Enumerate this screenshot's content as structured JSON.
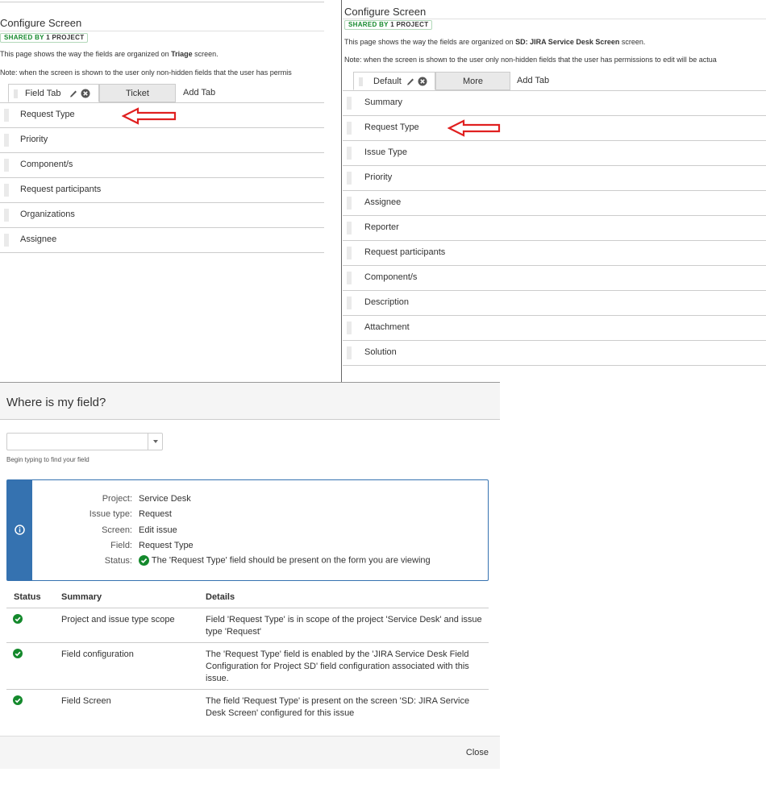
{
  "left": {
    "title": "Configure Screen",
    "shared_prefix": "SHARED BY",
    "shared_count": "1",
    "shared_suffix": "PROJECT",
    "desc_pre": "This page shows the way the fields are organized on",
    "desc_screen": "Triage",
    "desc_post": "screen.",
    "note": "Note: when the screen is shown to the user only non-hidden fields that the user has permis",
    "tabs": [
      {
        "label": "Field Tab"
      },
      {
        "label": "Ticket"
      }
    ],
    "add_tab": "Add Tab",
    "fields": [
      "Request Type",
      "Priority",
      "Component/s",
      "Request participants",
      "Organizations",
      "Assignee"
    ]
  },
  "right": {
    "title": "Configure Screen",
    "shared_prefix": "SHARED BY",
    "shared_count": "1",
    "shared_suffix": "PROJECT",
    "desc_pre": "This page shows the way the fields are organized on",
    "desc_screen": "SD: JIRA Service Desk Screen",
    "desc_post": "screen.",
    "note": "Note: when the screen is shown to the user only non-hidden fields that the user has permissions to edit will be actua",
    "tabs": [
      {
        "label": "Default"
      },
      {
        "label": "More"
      }
    ],
    "add_tab": "Add Tab",
    "fields": [
      "Summary",
      "Request Type",
      "Issue Type",
      "Priority",
      "Assignee",
      "Reporter",
      "Request participants",
      "Component/s",
      "Description",
      "Attachment",
      "Solution"
    ]
  },
  "dialog": {
    "title": "Where is my field?",
    "search_value": "",
    "hint": "Begin typing to find your field",
    "info": {
      "project_key": "Project:",
      "project_val": "Service Desk",
      "issue_type_key": "Issue type:",
      "issue_type_val": "Request",
      "screen_key": "Screen:",
      "screen_val": "Edit issue",
      "field_key": "Field:",
      "field_val": "Request Type",
      "status_key": "Status:",
      "status_val": "The 'Request Type' field should be present on the form you are viewing"
    },
    "table": {
      "headers": [
        "Status",
        "Summary",
        "Details"
      ],
      "rows": [
        {
          "summary": "Project and issue type scope",
          "details": "Field 'Request Type' is in scope of the project 'Service Desk' and issue type 'Request'"
        },
        {
          "summary": "Field configuration",
          "details": "The 'Request Type' field is enabled by the 'JIRA Service Desk Field Configuration for Project SD' field configuration associated with this issue."
        },
        {
          "summary": "Field Screen",
          "details": "The field 'Request Type' is present on the screen 'SD: JIRA Service Desk Screen' configured for this issue"
        }
      ]
    },
    "close_label": "Close"
  },
  "colors": {
    "accent_blue": "#3572b0",
    "success_green": "#14892c",
    "arrow_red": "#e02020"
  },
  "icons": [
    "pencil-icon",
    "remove-circle-icon",
    "drag-handle-icon",
    "red-arrow-icon",
    "info-icon",
    "check-circle-icon",
    "chevron-down-icon"
  ]
}
